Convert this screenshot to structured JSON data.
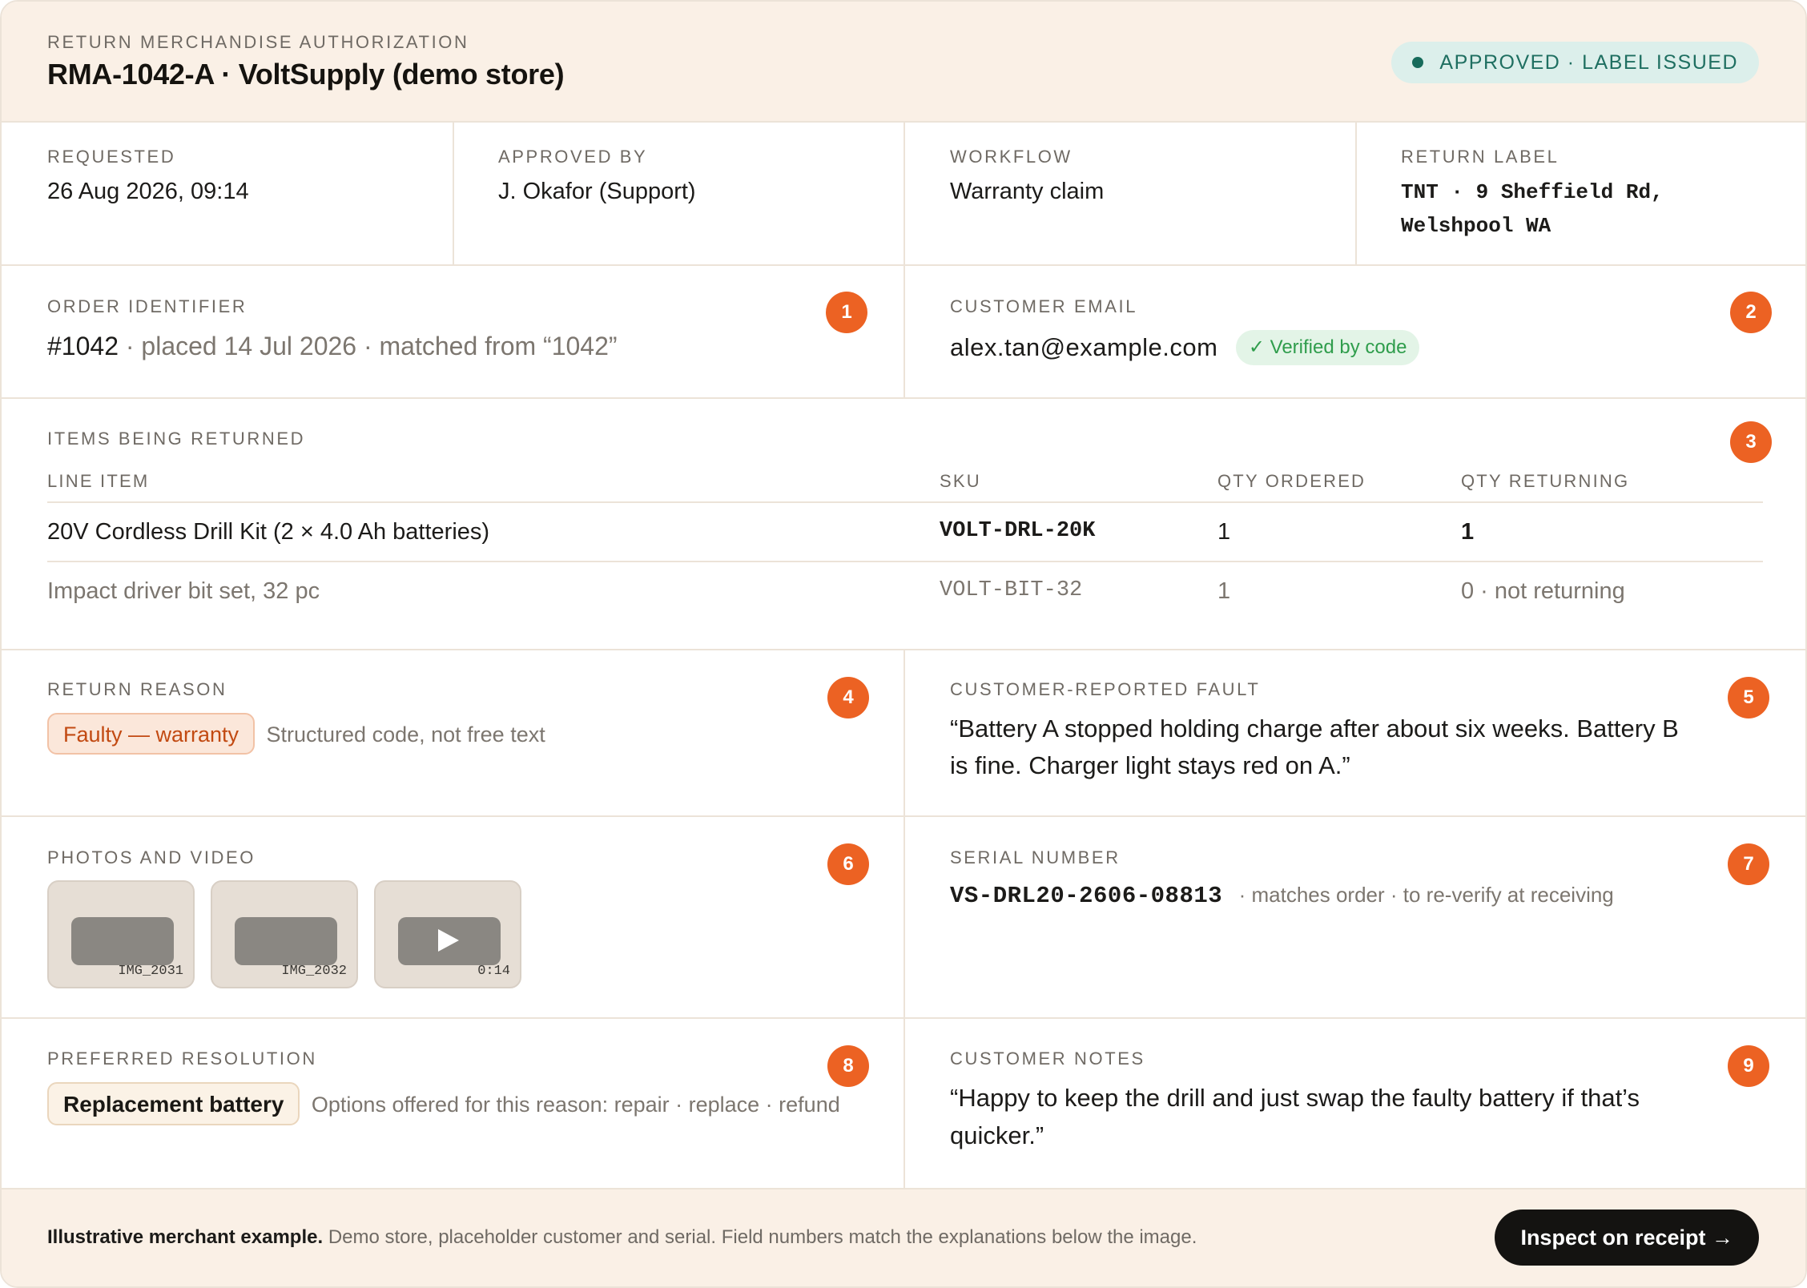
{
  "header": {
    "eyebrow": "RETURN MERCHANDISE AUTHORIZATION",
    "title": "RMA-1042-A · VoltSupply (demo store)",
    "status": "APPROVED · LABEL ISSUED"
  },
  "meta": {
    "requested_label": "REQUESTED",
    "requested_value": "26 Aug 2026, 09:14",
    "approved_label": "APPROVED BY",
    "approved_value": "J. Okafor (Support)",
    "workflow_label": "WORKFLOW",
    "workflow_value": "Warranty claim",
    "return_label_label": "RETURN LABEL",
    "return_label_line1": "TNT · 9 Sheffield Rd,",
    "return_label_line2": "Welshpool WA"
  },
  "order": {
    "label": "ORDER IDENTIFIER",
    "number": "#1042",
    "detail": "· placed 14 Jul 2026 · matched from “1042”",
    "badge": "1"
  },
  "email": {
    "label": "CUSTOMER EMAIL",
    "value": "alex.tan@example.com",
    "chip": "✓ Verified by code",
    "badge": "2"
  },
  "items": {
    "label": "ITEMS BEING RETURNED",
    "badge": "3",
    "columns": [
      "LINE ITEM",
      "SKU",
      "QTY ORDERED",
      "QTY RETURNING"
    ],
    "rows": [
      {
        "name": "20V Cordless Drill Kit (2 × 4.0 Ah batteries)",
        "sku": "VOLT-DRL-20K",
        "qty_ordered": "1",
        "qty_returning": "1"
      },
      {
        "name": "Impact driver bit set, 32 pc",
        "sku": "VOLT-BIT-32",
        "qty_ordered": "1",
        "qty_returning": "0 · not returning"
      }
    ]
  },
  "reason": {
    "label": "RETURN REASON",
    "chip": "Faulty — warranty",
    "note": "Structured code, not free text",
    "badge": "4"
  },
  "fault": {
    "label": "CUSTOMER-REPORTED FAULT",
    "line1": "“Battery A stopped holding charge after about six weeks. Battery B",
    "line2": "is fine. Charger light stays red on A.”",
    "badge": "5"
  },
  "media": {
    "label": "PHOTOS AND VIDEO",
    "badge": "6",
    "items": [
      {
        "caption": "IMG_2031"
      },
      {
        "caption": "IMG_2032"
      },
      {
        "caption": "0:14"
      }
    ]
  },
  "serial": {
    "label": "SERIAL NUMBER",
    "value": "VS-DRL20-2606-08813",
    "note": "· matches order · to re-verify at receiving",
    "badge": "7"
  },
  "resolution": {
    "label": "PREFERRED RESOLUTION",
    "chip": "Replacement battery",
    "note": "Options offered for this reason: repair · replace · refund",
    "badge": "8"
  },
  "notes": {
    "label": "CUSTOMER NOTES",
    "line1": "“Happy to keep the drill and just swap the faulty battery if that’s",
    "line2": "quicker.”",
    "badge": "9"
  },
  "footer": {
    "bold": "Illustrative merchant example.",
    "text": " Demo store, placeholder customer and serial. Field numbers match the explanations below the image.",
    "cta": "Inspect on receipt →"
  },
  "colors": {
    "accent_badge": "#ec6223",
    "status_green": "#176b5b",
    "header_bg": "#faf0e6",
    "cta_bg": "#141311"
  }
}
